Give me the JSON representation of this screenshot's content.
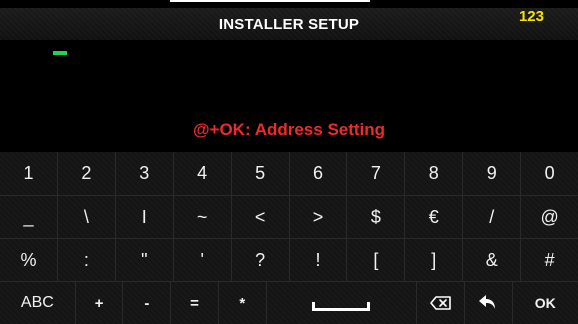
{
  "header": {
    "title": "INSTALLER SETUP",
    "mode_indicator": "123"
  },
  "hint": "@+OK: Address Setting",
  "keyboard": {
    "row1": [
      "1",
      "2",
      "3",
      "4",
      "5",
      "6",
      "7",
      "8",
      "9",
      "0"
    ],
    "row2": [
      "_",
      "\\",
      "I",
      "~",
      "<",
      ">",
      "$",
      "€",
      "/",
      "@"
    ],
    "row3": [
      "%",
      ":",
      "\"",
      "'",
      "?",
      "!",
      "[",
      "]",
      "&",
      "#"
    ],
    "row4": {
      "abc": "ABC",
      "plus": "+",
      "minus": "-",
      "equals": "=",
      "asterisk": "*",
      "ok": "OK"
    }
  },
  "colors": {
    "accent_yellow": "#f5e300",
    "hint_red": "#ee2a2a",
    "cursor_green": "#1fd25a"
  }
}
